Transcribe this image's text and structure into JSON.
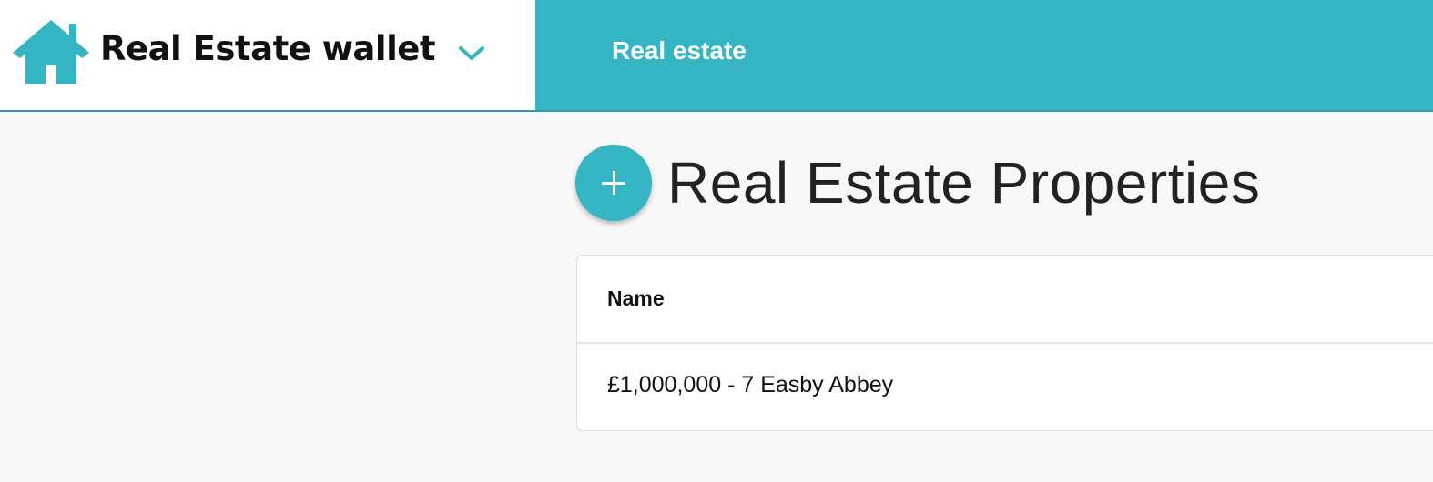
{
  "header": {
    "brand_title": "Real Estate wallet",
    "brand_icon": "house-icon",
    "menu_icon": "chevron-down-icon",
    "nav_items": [
      {
        "label": "Real estate"
      }
    ]
  },
  "main": {
    "add_icon": "plus-icon",
    "title": "Real Estate Properties",
    "table": {
      "columns": [
        "Name"
      ],
      "rows": [
        [
          "£1,000,000 - 7 Easby Abbey"
        ]
      ]
    }
  },
  "colors": {
    "accent": "#34b5c3",
    "accent_dark": "#2a9ea9",
    "background": "#f8f8f8",
    "text": "#111111"
  }
}
